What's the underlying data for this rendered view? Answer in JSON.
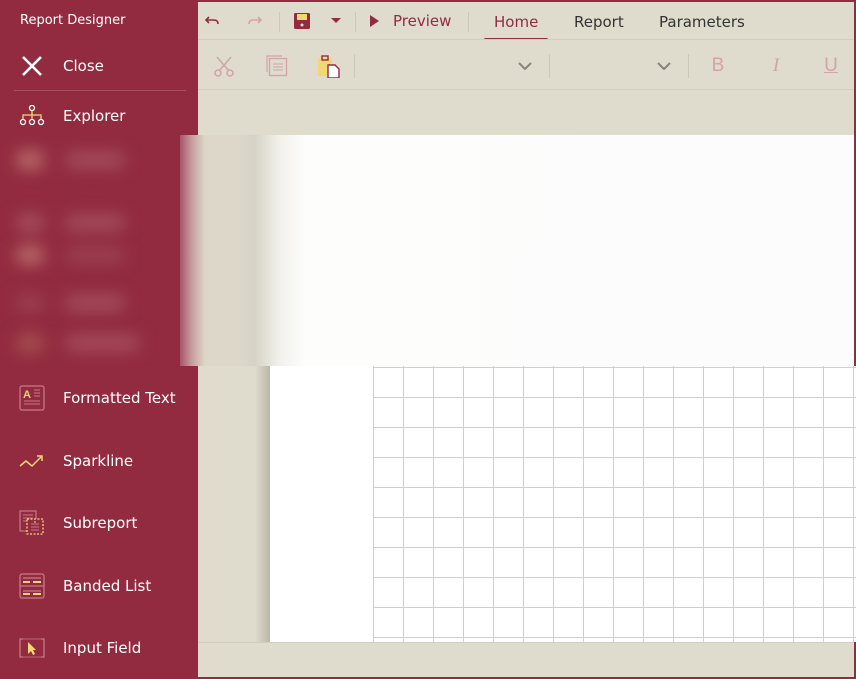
{
  "app": {
    "title": "Report Designer"
  },
  "sidebar": {
    "close_label": "Close",
    "items": [
      {
        "label": "Explorer",
        "icon": "hierarchy-icon"
      },
      {
        "label": "Formatted Text",
        "icon": "formatted-text-icon"
      },
      {
        "label": "Sparkline",
        "icon": "sparkline-icon"
      },
      {
        "label": "Subreport",
        "icon": "subreport-icon"
      },
      {
        "label": "Banded List",
        "icon": "banded-list-icon"
      },
      {
        "label": "Input Field",
        "icon": "input-field-icon"
      }
    ]
  },
  "toolbar": {
    "undo": "undo-icon",
    "redo": "redo-icon",
    "save": "save-icon",
    "save_dropdown": "caret-down-icon",
    "preview_label": "Preview"
  },
  "tabs": [
    {
      "label": "Home",
      "active": true
    },
    {
      "label": "Report",
      "active": false
    },
    {
      "label": "Parameters",
      "active": false
    }
  ],
  "ribbon": {
    "cut": "scissors-icon",
    "copy": "copy-icon",
    "paste": "paste-icon",
    "font_family_value": "",
    "font_size_value": "",
    "bold_label": "B",
    "italic_label": "I",
    "underline_label": "U"
  },
  "colors": {
    "accent": "#922b40",
    "background": "#dfdbcd",
    "icon_highlight": "#f2d774",
    "grid_line": "#cfcfcf"
  }
}
